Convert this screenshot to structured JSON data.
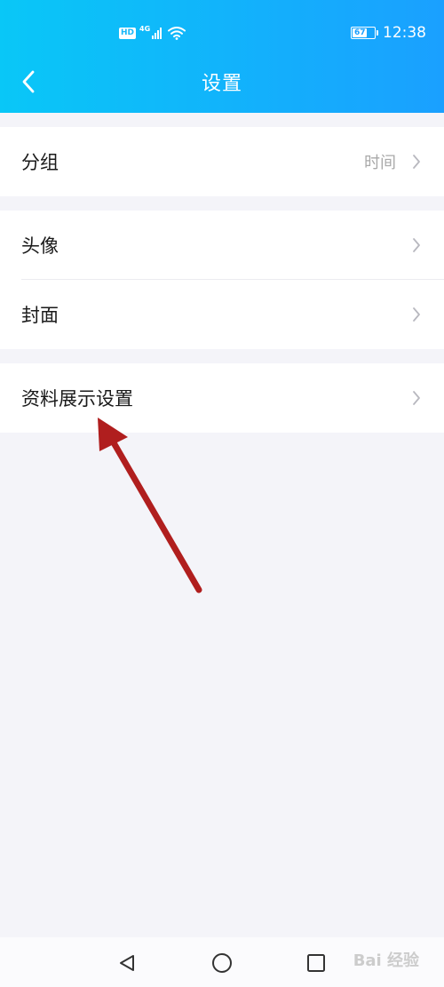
{
  "status_bar": {
    "network_badge": "HD",
    "network_gen": "4G",
    "battery_level": "67",
    "time": "12:38"
  },
  "header": {
    "title": "设置",
    "back_icon": "chevron-left-icon",
    "background_start": "#09c7f7",
    "background_end": "#1aa0ff"
  },
  "groups": [
    {
      "items": [
        {
          "label": "分组",
          "value": "时间"
        }
      ]
    },
    {
      "items": [
        {
          "label": "头像"
        },
        {
          "label": "封面"
        }
      ]
    },
    {
      "items": [
        {
          "label": "资料展示设置"
        }
      ]
    }
  ],
  "nav_bar": {
    "back": "triangle-back-icon",
    "home": "circle-home-icon",
    "recents": "square-recents-icon"
  },
  "annotation": {
    "arrow_color": "#b01e1e"
  },
  "watermark": "Bai 经验"
}
